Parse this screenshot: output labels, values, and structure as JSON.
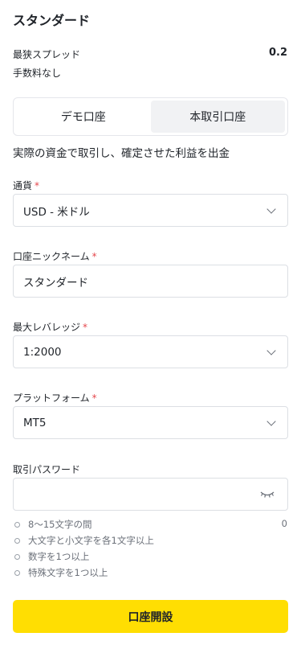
{
  "title": "スタンダード",
  "spread": {
    "label": "最狭スプレッド",
    "value": "0.2"
  },
  "fee": {
    "label": "手数料なし"
  },
  "account_types": {
    "demo": "デモ口座",
    "real": "本取引口座",
    "selected": "本取引口座"
  },
  "description": "実際の資金で取引し、確定させた利益を出金",
  "currency": {
    "label": "通貨",
    "required_mark": "*",
    "value": "USD - 米ドル"
  },
  "nickname": {
    "label": "口座ニックネーム",
    "required_mark": "*",
    "value": "スタンダード"
  },
  "leverage": {
    "label": "最大レバレッジ",
    "required_mark": "*",
    "value": "1:2000"
  },
  "platform": {
    "label": "プラットフォーム",
    "required_mark": "*",
    "value": "MT5"
  },
  "password": {
    "label": "取引パスワード",
    "value": "",
    "counter": "0",
    "rules": [
      "8〜15文字の間",
      "大文字と小文字を各1文字以上",
      "数字を1つ以上",
      "特殊文字を1つ以上"
    ]
  },
  "submit_label": "口座開設",
  "colors": {
    "accent": "#ffde02",
    "required": "#e5484d"
  }
}
